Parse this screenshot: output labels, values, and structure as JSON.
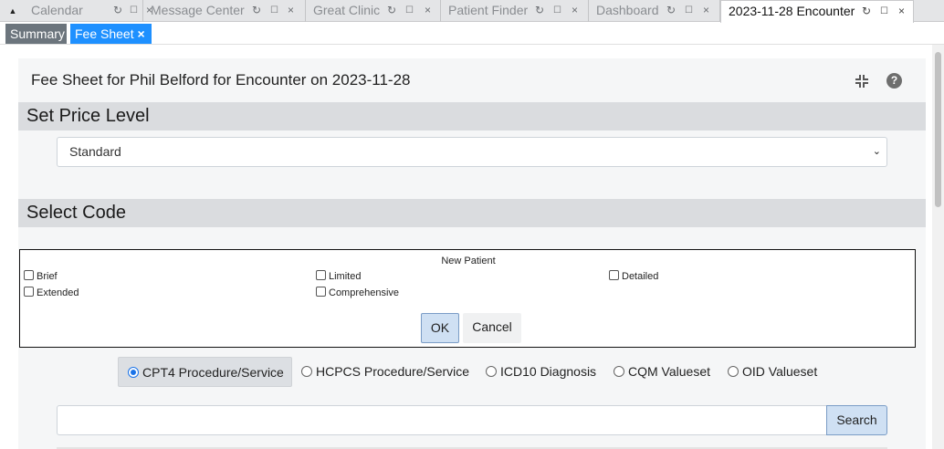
{
  "tabs": [
    {
      "label": "Calendar",
      "active": false
    },
    {
      "label": "Message Center",
      "active": false
    },
    {
      "label": "Great Clinic",
      "active": false
    },
    {
      "label": "Patient Finder",
      "active": false
    },
    {
      "label": "Dashboard",
      "active": false
    },
    {
      "label": "2023-11-28 Encounter",
      "active": true
    }
  ],
  "tab_icons": {
    "refresh": "↻",
    "lock": "🔓",
    "close": "×",
    "collapse": "▲"
  },
  "subtabs": {
    "summary": "Summary",
    "fee_sheet": "Fee Sheet",
    "fee_close": "×"
  },
  "page": {
    "title": "Fee Sheet for Phil Belford for Encounter on 2023-11-28",
    "help": "?"
  },
  "price_level": {
    "heading": "Set Price Level",
    "selected": "Standard"
  },
  "select_code": {
    "heading": "Select Code"
  },
  "dialog": {
    "title": "New Patient",
    "options": [
      "Brief",
      "Limited",
      "Detailed",
      "Extended",
      "Comprehensive"
    ],
    "ok": "OK",
    "cancel": "Cancel"
  },
  "code_types": [
    {
      "label": "CPT4 Procedure/Service",
      "selected": true
    },
    {
      "label": "HCPCS Procedure/Service",
      "selected": false
    },
    {
      "label": "ICD10 Diagnosis",
      "selected": false
    },
    {
      "label": "CQM Valueset",
      "selected": false
    },
    {
      "label": "OID Valueset",
      "selected": false
    }
  ],
  "search": {
    "value": "",
    "button": "Search"
  },
  "colors": {
    "accent": "#1e90ff",
    "summary_tab": "#6c757d",
    "button_blue": "#cfe0f3"
  }
}
